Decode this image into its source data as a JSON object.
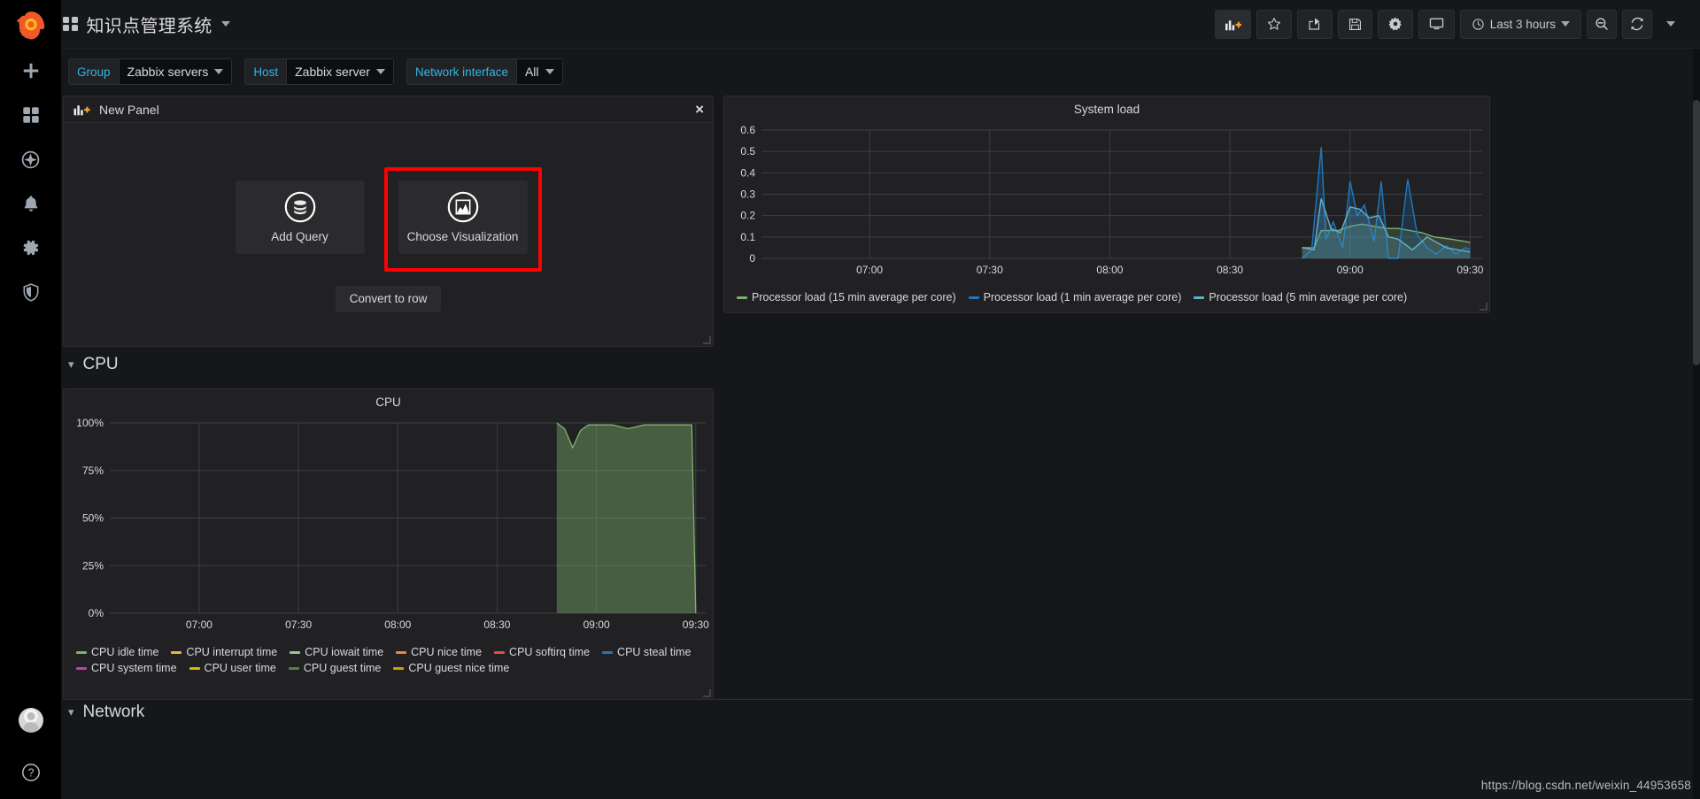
{
  "app": {
    "brand_icon": "grafana-logo",
    "dashboard_title": "知识点管理系统"
  },
  "sidebar": {
    "items": [
      {
        "name": "create-icon",
        "label": "Create"
      },
      {
        "name": "dashboards-icon",
        "label": "Dashboards"
      },
      {
        "name": "explore-icon",
        "label": "Explore"
      },
      {
        "name": "alerting-icon",
        "label": "Alerting"
      },
      {
        "name": "configuration-icon",
        "label": "Configuration"
      },
      {
        "name": "server-admin-icon",
        "label": "Server Admin"
      }
    ],
    "avatar_label": "User profile",
    "help_label": "Help"
  },
  "toolbar": {
    "add_panel_label": "Add panel",
    "star_label": "Mark as favorite",
    "share_label": "Share dashboard",
    "save_label": "Save dashboard",
    "settings_label": "Dashboard settings",
    "tv_label": "Cycle view mode",
    "time_range": "Last 3 hours",
    "zoom_out_label": "Zoom out time range",
    "refresh_label": "Refresh dashboard",
    "refresh_interval_label": "Refresh interval"
  },
  "variables": [
    {
      "label": "Group",
      "value": "Zabbix servers"
    },
    {
      "label": "Host",
      "value": "Zabbix server"
    },
    {
      "label": "Network interface",
      "value": "All"
    }
  ],
  "new_panel": {
    "title": "New Panel",
    "close_label": "×",
    "add_query_label": "Add Query",
    "choose_visualization_label": "Choose Visualization",
    "convert_to_row_label": "Convert to row",
    "highlight_color": "#ff0000"
  },
  "rows": [
    {
      "label": "CPU",
      "collapsed": false
    },
    {
      "label": "Network",
      "collapsed": false
    }
  ],
  "watermark": "https://blog.csdn.net/weixin_44953658",
  "chart_data": [
    {
      "id": "system-load",
      "type": "line",
      "title": "System load",
      "xlabel": "",
      "ylabel": "",
      "ylim": [
        0,
        0.6
      ],
      "yticks": [
        "0",
        "0.1",
        "0.2",
        "0.3",
        "0.4",
        "0.5",
        "0.6"
      ],
      "xticks": [
        "07:00",
        "07:30",
        "08:00",
        "08:30",
        "09:00",
        "09:30"
      ],
      "grid": true,
      "legend_position": "bottom",
      "series": [
        {
          "name": "Processor load (15 min average per core)",
          "color": "#7eb26d",
          "x": [
            8.8,
            8.85,
            8.88,
            8.92,
            8.95,
            9.0,
            9.05,
            9.1,
            9.15,
            9.2,
            9.25,
            9.3,
            9.35,
            9.42,
            9.5
          ],
          "values": [
            0.05,
            0.05,
            0.13,
            0.13,
            0.13,
            0.15,
            0.16,
            0.15,
            0.14,
            0.14,
            0.13,
            0.12,
            0.1,
            0.09,
            0.075
          ]
        },
        {
          "name": "Processor load (1 min average per core)",
          "color": "#1f78c1",
          "x": [
            8.8,
            8.84,
            8.88,
            8.9,
            8.93,
            8.97,
            9.0,
            9.03,
            9.06,
            9.1,
            9.13,
            9.16,
            9.2,
            9.24,
            9.28,
            9.32,
            9.36,
            9.4,
            9.44,
            9.48,
            9.5
          ],
          "values": [
            0.0,
            0.04,
            0.52,
            0.09,
            0.17,
            0.05,
            0.36,
            0.2,
            0.25,
            0.08,
            0.36,
            0.0,
            0.0,
            0.37,
            0.11,
            0.05,
            0.02,
            0.06,
            0.02,
            0.05,
            0.04
          ]
        },
        {
          "name": "Processor load (5 min average per core)",
          "color": "#64b0c8",
          "x": [
            8.8,
            8.85,
            8.88,
            8.92,
            8.96,
            9.0,
            9.04,
            9.08,
            9.12,
            9.16,
            9.2,
            9.26,
            9.32,
            9.4,
            9.5
          ],
          "values": [
            0.05,
            0.04,
            0.28,
            0.14,
            0.12,
            0.24,
            0.23,
            0.19,
            0.2,
            0.1,
            0.09,
            0.04,
            0.1,
            0.05,
            0.03
          ]
        }
      ]
    },
    {
      "id": "cpu",
      "type": "area",
      "title": "CPU",
      "xlabel": "",
      "ylabel": "",
      "ylim": [
        0,
        100
      ],
      "yticks": [
        "0%",
        "25%",
        "50%",
        "75%",
        "100%"
      ],
      "xticks": [
        "07:00",
        "07:30",
        "08:00",
        "08:30",
        "09:00",
        "09:30"
      ],
      "grid": true,
      "legend_position": "bottom",
      "series": [
        {
          "name": "CPU idle time",
          "color": "#7eb26d",
          "x": [
            8.8,
            8.84,
            8.88,
            8.92,
            8.96,
            9.0,
            9.08,
            9.16,
            9.24,
            9.32,
            9.4,
            9.48,
            9.5
          ],
          "values": [
            100,
            97,
            87,
            96,
            99,
            99,
            99,
            97,
            99,
            99,
            99,
            99,
            0
          ]
        },
        {
          "name": "CPU interrupt time",
          "color": "#eab839",
          "x": [],
          "values": []
        },
        {
          "name": "CPU iowait time",
          "color": "#9ac48a",
          "x": [],
          "values": []
        },
        {
          "name": "CPU nice time",
          "color": "#ef843c",
          "x": [],
          "values": []
        },
        {
          "name": "CPU softirq time",
          "color": "#e24d42",
          "x": [],
          "values": []
        },
        {
          "name": "CPU steal time",
          "color": "#1f78c1",
          "x": [],
          "values": []
        },
        {
          "name": "CPU system time",
          "color": "#ba43a9",
          "x": [],
          "values": []
        },
        {
          "name": "CPU user time",
          "color": "#e0b400",
          "x": [],
          "values": []
        },
        {
          "name": "CPU guest time",
          "color": "#508642",
          "x": [],
          "values": []
        },
        {
          "name": "CPU guest nice time",
          "color": "#cca300",
          "x": [],
          "values": []
        }
      ]
    }
  ]
}
